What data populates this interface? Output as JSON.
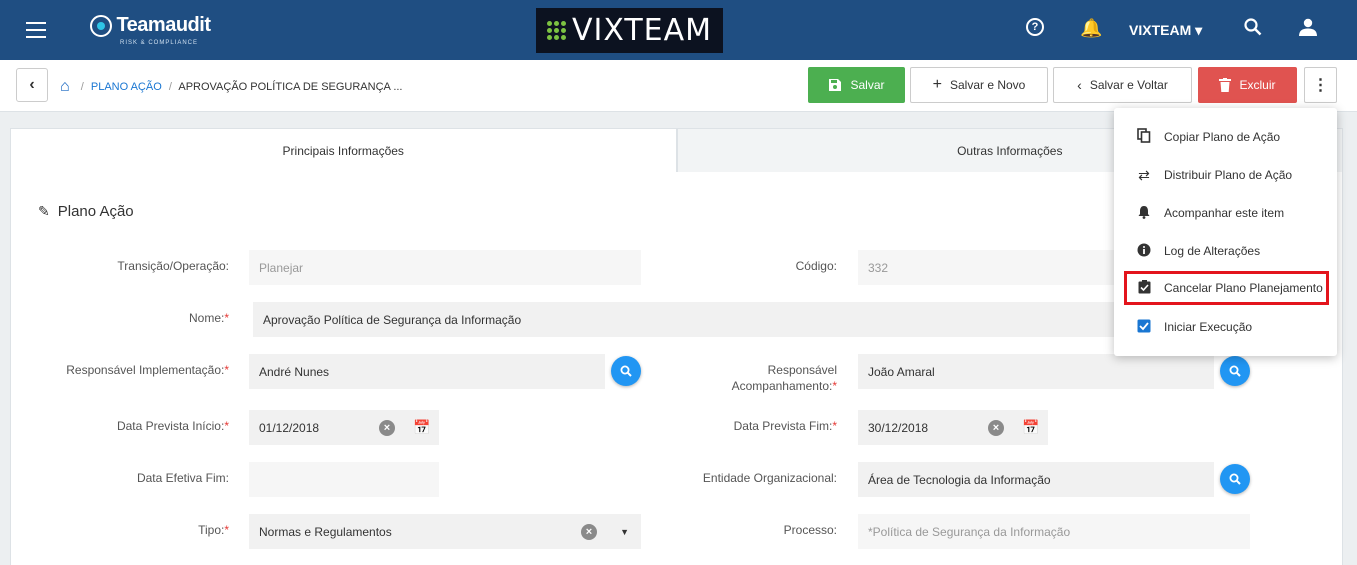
{
  "app": {
    "logo_name": "Teamaudit",
    "logo_sub": "RISK & COMPLIANCE",
    "brand": "VIXTEAM",
    "user_menu": "VIXTEAM",
    "colors": {
      "header": "#1f4e82",
      "save": "#4caf50",
      "delete": "#e05350",
      "highlight": "#e3141c",
      "accent": "#2196f3"
    }
  },
  "breadcrumb": {
    "items": [
      "PLANO AÇÃO",
      "APROVAÇÃO POLÍTICA DE SEGURANÇA ..."
    ]
  },
  "toolbar": {
    "save": "Salvar",
    "save_new": "Salvar e Novo",
    "save_back": "Salvar e Voltar",
    "delete": "Excluir"
  },
  "tabs": [
    "Principais Informações",
    "Outras Informações"
  ],
  "section": {
    "title": "Plano Ação"
  },
  "form": {
    "transicao": {
      "label": "Transição/Operação:",
      "value": "Planejar"
    },
    "codigo": {
      "label": "Código:",
      "value": "332"
    },
    "nome": {
      "label": "Nome:",
      "value": "Aprovação Política de Segurança da Informação"
    },
    "resp_impl": {
      "label": "Responsável Implementação:",
      "value": "André Nunes"
    },
    "resp_acomp": {
      "label_1": "Responsável",
      "label_2": "Acompanhamento:",
      "value": "João Amaral"
    },
    "data_inicio": {
      "label": "Data Prevista Início:",
      "value": "01/12/2018"
    },
    "data_fim": {
      "label": "Data Prevista Fim:",
      "value": "30/12/2018"
    },
    "data_efetiva": {
      "label": "Data Efetiva Fim:",
      "value": ""
    },
    "entidade": {
      "label": "Entidade Organizacional:",
      "value": "Área de Tecnologia da Informação"
    },
    "tipo": {
      "label": "Tipo:",
      "value": "Normas e Regulamentos"
    },
    "processo": {
      "label": "Processo:",
      "value": "*Política de Segurança da Informação"
    }
  },
  "menu": {
    "items": [
      {
        "label": "Copiar Plano de Ação",
        "icon": "copy-icon"
      },
      {
        "label": "Distribuir Plano de Ação",
        "icon": "repeat-icon"
      },
      {
        "label": "Acompanhar este item",
        "icon": "bell-icon"
      },
      {
        "label": "Log de Alterações",
        "icon": "info-icon"
      },
      {
        "label": "Cancelar Plano Planejamento",
        "icon": "assignment-check-icon"
      },
      {
        "label": "Iniciar Execução",
        "icon": "checkbox-icon"
      }
    ]
  }
}
